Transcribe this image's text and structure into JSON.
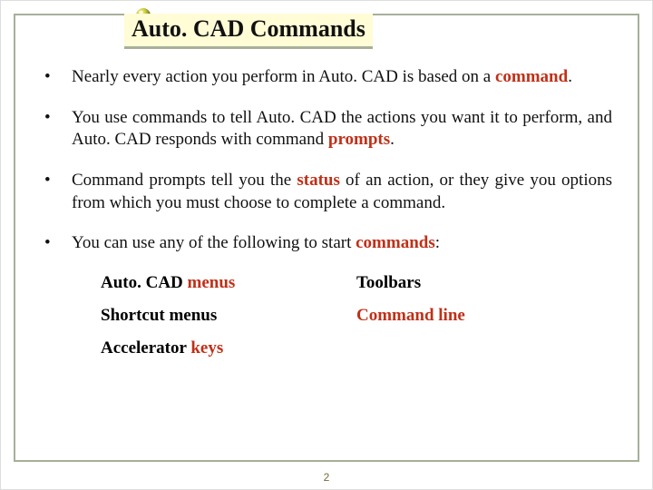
{
  "title": "Auto. CAD Commands",
  "bullets": {
    "b1_a": "Nearly every action you perform in Auto. CAD is based on a ",
    "b1_b": "command",
    "b1_c": ". ",
    "b2_a": "You use commands to tell Auto. CAD the actions you want it to perform, and Auto. CAD responds with command ",
    "b2_b": "prompts",
    "b2_c": ". ",
    "b3_a": "Command prompts tell you the ",
    "b3_b": "status",
    "b3_c": " of an action, or they give you options from which you must choose to complete a command.",
    "b4_a": "You can use any of the following to start ",
    "b4_b": "commands",
    "b4_c": ":"
  },
  "sub": {
    "r1c1_a": "Auto. CAD ",
    "r1c1_b": "menus",
    "r1c2": "Toolbars",
    "r2c1": "Shortcut menus",
    "r2c2": "Command line",
    "r3c1_a": "Accelerator ",
    "r3c1_b": "keys"
  },
  "page": "2"
}
